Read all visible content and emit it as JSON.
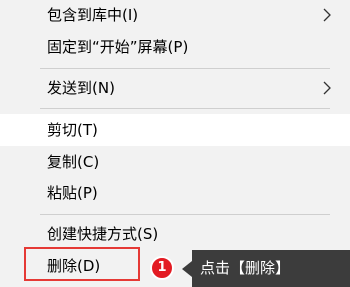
{
  "context_menu": {
    "items": [
      {
        "label": "包含到库中(I)",
        "has_submenu": true
      },
      {
        "label": "固定到“开始”屏幕(P)",
        "has_submenu": false
      },
      {
        "label": "发送到(N)",
        "has_submenu": true
      },
      {
        "label": "剪切(T)",
        "has_submenu": false
      },
      {
        "label": "复制(C)",
        "has_submenu": false
      },
      {
        "label": "粘贴(P)",
        "has_submenu": false
      },
      {
        "label": "创建快捷方式(S)",
        "has_submenu": false
      },
      {
        "label": "删除(D)",
        "has_submenu": false
      }
    ],
    "submenu_icon": "chevron-right-icon"
  },
  "annotation": {
    "step_number": "1",
    "tooltip_text": "点击【删除】",
    "highlight_color": "#e53935",
    "badge_color": "#e31b23",
    "tooltip_bg": "#3c3c3c"
  },
  "colors": {
    "menu_bg": "#f2f2f2",
    "hover_bg": "#ffffff",
    "separator": "#cfcfcf"
  }
}
